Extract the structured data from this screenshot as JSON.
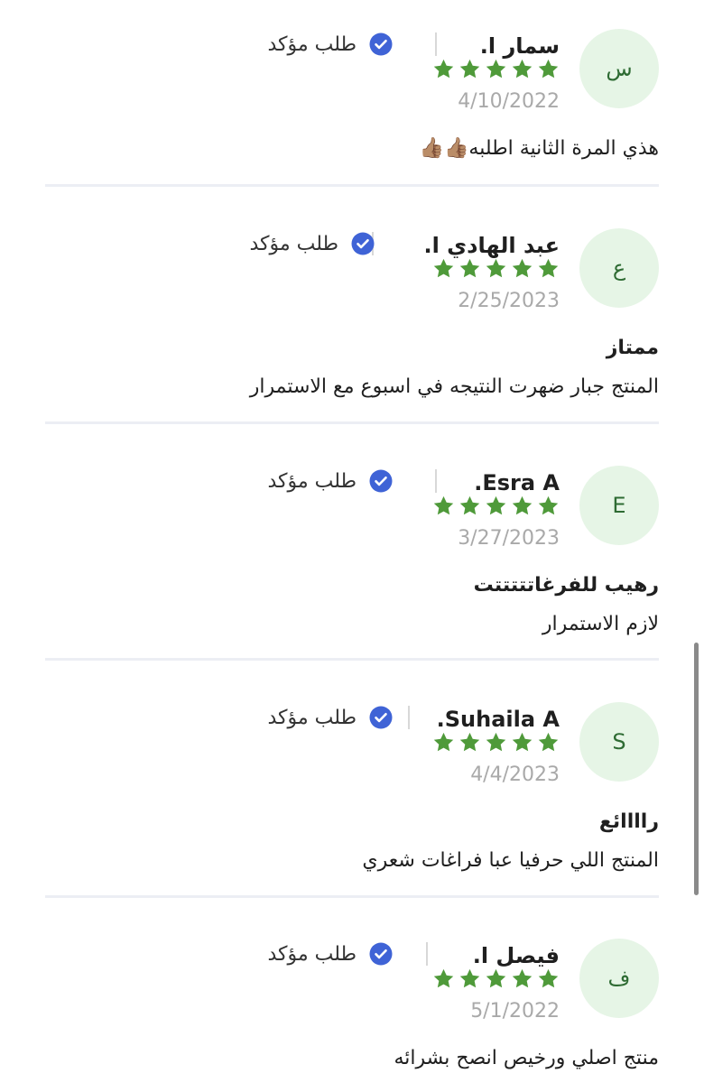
{
  "reviews": [
    {
      "avatar": "س",
      "name": "سمار ا.",
      "verified": "طلب مؤكد",
      "rating": 5,
      "date": "4/10/2022",
      "title": "",
      "body": "هذي المرة الثانية اطلبه👍🏽👍🏽"
    },
    {
      "avatar": "ع",
      "name": "عبد الهادي ا.",
      "verified": "طلب مؤكد",
      "rating": 5,
      "date": "2/25/2023",
      "title": "ممتاز",
      "body": "المنتج جبار ضهرت النتيجه في اسبوع مع الاستمرار"
    },
    {
      "avatar": "E",
      "name": "Esra A.",
      "verified": "طلب مؤكد",
      "rating": 5,
      "date": "3/27/2023",
      "title": "رهيب للفرغاتتتتتت",
      "body": "لازم الاستمرار"
    },
    {
      "avatar": "S",
      "name": "Suhaila A.",
      "verified": "طلب مؤكد",
      "rating": 5,
      "date": "4/4/2023",
      "title": "راااائع",
      "body": "المنتج اللي حرفيا عبا فراغات شعري"
    },
    {
      "avatar": "ف",
      "name": "فيصل ا.",
      "verified": "طلب مؤكد",
      "rating": 5,
      "date": "5/1/2022",
      "title": "",
      "body": "منتج اصلي ورخيص انصح بشرائه"
    }
  ],
  "colors": {
    "star": "#4f9a3a",
    "verified_badge": "#3f63d6",
    "avatar_bg": "#e6f5e6",
    "date": "#a9a9a9"
  },
  "icons": {
    "star": "star-icon",
    "verified": "check-circle-icon"
  }
}
